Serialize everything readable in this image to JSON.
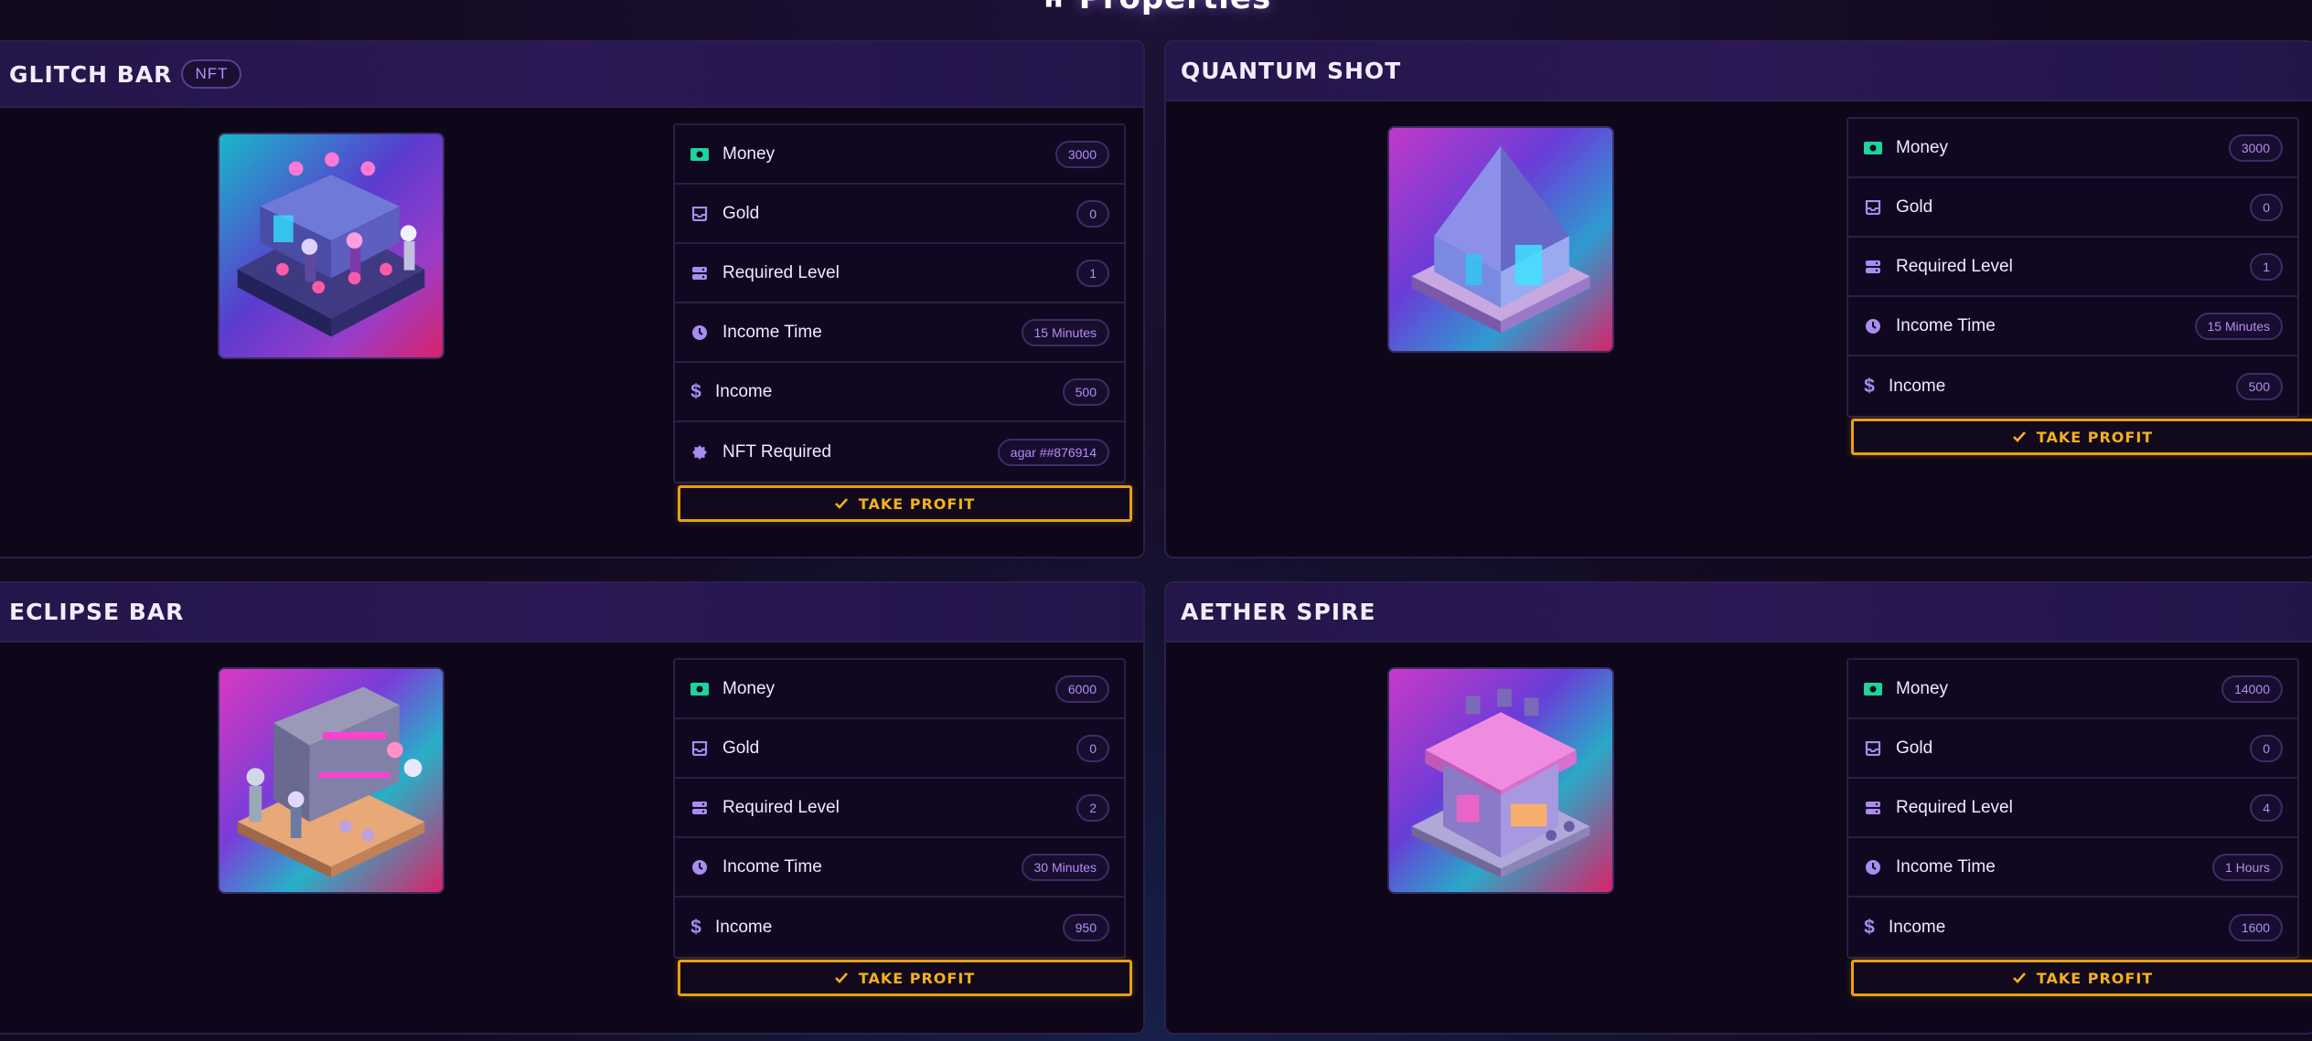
{
  "page": {
    "title": "Properties"
  },
  "colors": {
    "accent": "#e8a010",
    "badge_text": "#b48cf5",
    "money_icon": "#1fd39a",
    "purple_icon": "#a98cf0"
  },
  "cards": [
    {
      "title": "GLITCH BAR",
      "badge": "NFT",
      "stats": [
        {
          "icon": "money-icon",
          "label": "Money",
          "value": "3000"
        },
        {
          "icon": "gold-icon",
          "label": "Gold",
          "value": "0"
        },
        {
          "icon": "level-icon",
          "label": "Required Level",
          "value": "1"
        },
        {
          "icon": "clock-icon",
          "label": "Income Time",
          "value": "15 Minutes"
        },
        {
          "icon": "dollar-icon",
          "label": "Income",
          "value": "500"
        },
        {
          "icon": "nft-icon",
          "label": "NFT Required",
          "value": "agar ##876914"
        }
      ],
      "button": "TAKE PROFIT"
    },
    {
      "title": "QUANTUM SHOT",
      "stats": [
        {
          "icon": "money-icon",
          "label": "Money",
          "value": "3000"
        },
        {
          "icon": "gold-icon",
          "label": "Gold",
          "value": "0"
        },
        {
          "icon": "level-icon",
          "label": "Required Level",
          "value": "1"
        },
        {
          "icon": "clock-icon",
          "label": "Income Time",
          "value": "15 Minutes"
        },
        {
          "icon": "dollar-icon",
          "label": "Income",
          "value": "500"
        }
      ],
      "button": "TAKE PROFIT"
    },
    {
      "title": "ECLIPSE BAR",
      "stats": [
        {
          "icon": "money-icon",
          "label": "Money",
          "value": "6000"
        },
        {
          "icon": "gold-icon",
          "label": "Gold",
          "value": "0"
        },
        {
          "icon": "level-icon",
          "label": "Required Level",
          "value": "2"
        },
        {
          "icon": "clock-icon",
          "label": "Income Time",
          "value": "30 Minutes"
        },
        {
          "icon": "dollar-icon",
          "label": "Income",
          "value": "950"
        }
      ],
      "button": "TAKE PROFIT"
    },
    {
      "title": "AETHER SPIRE",
      "stats": [
        {
          "icon": "money-icon",
          "label": "Money",
          "value": "14000"
        },
        {
          "icon": "gold-icon",
          "label": "Gold",
          "value": "0"
        },
        {
          "icon": "level-icon",
          "label": "Required Level",
          "value": "4"
        },
        {
          "icon": "clock-icon",
          "label": "Income Time",
          "value": "1 Hours"
        },
        {
          "icon": "dollar-icon",
          "label": "Income",
          "value": "1600"
        }
      ],
      "button": "TAKE PROFIT"
    }
  ]
}
